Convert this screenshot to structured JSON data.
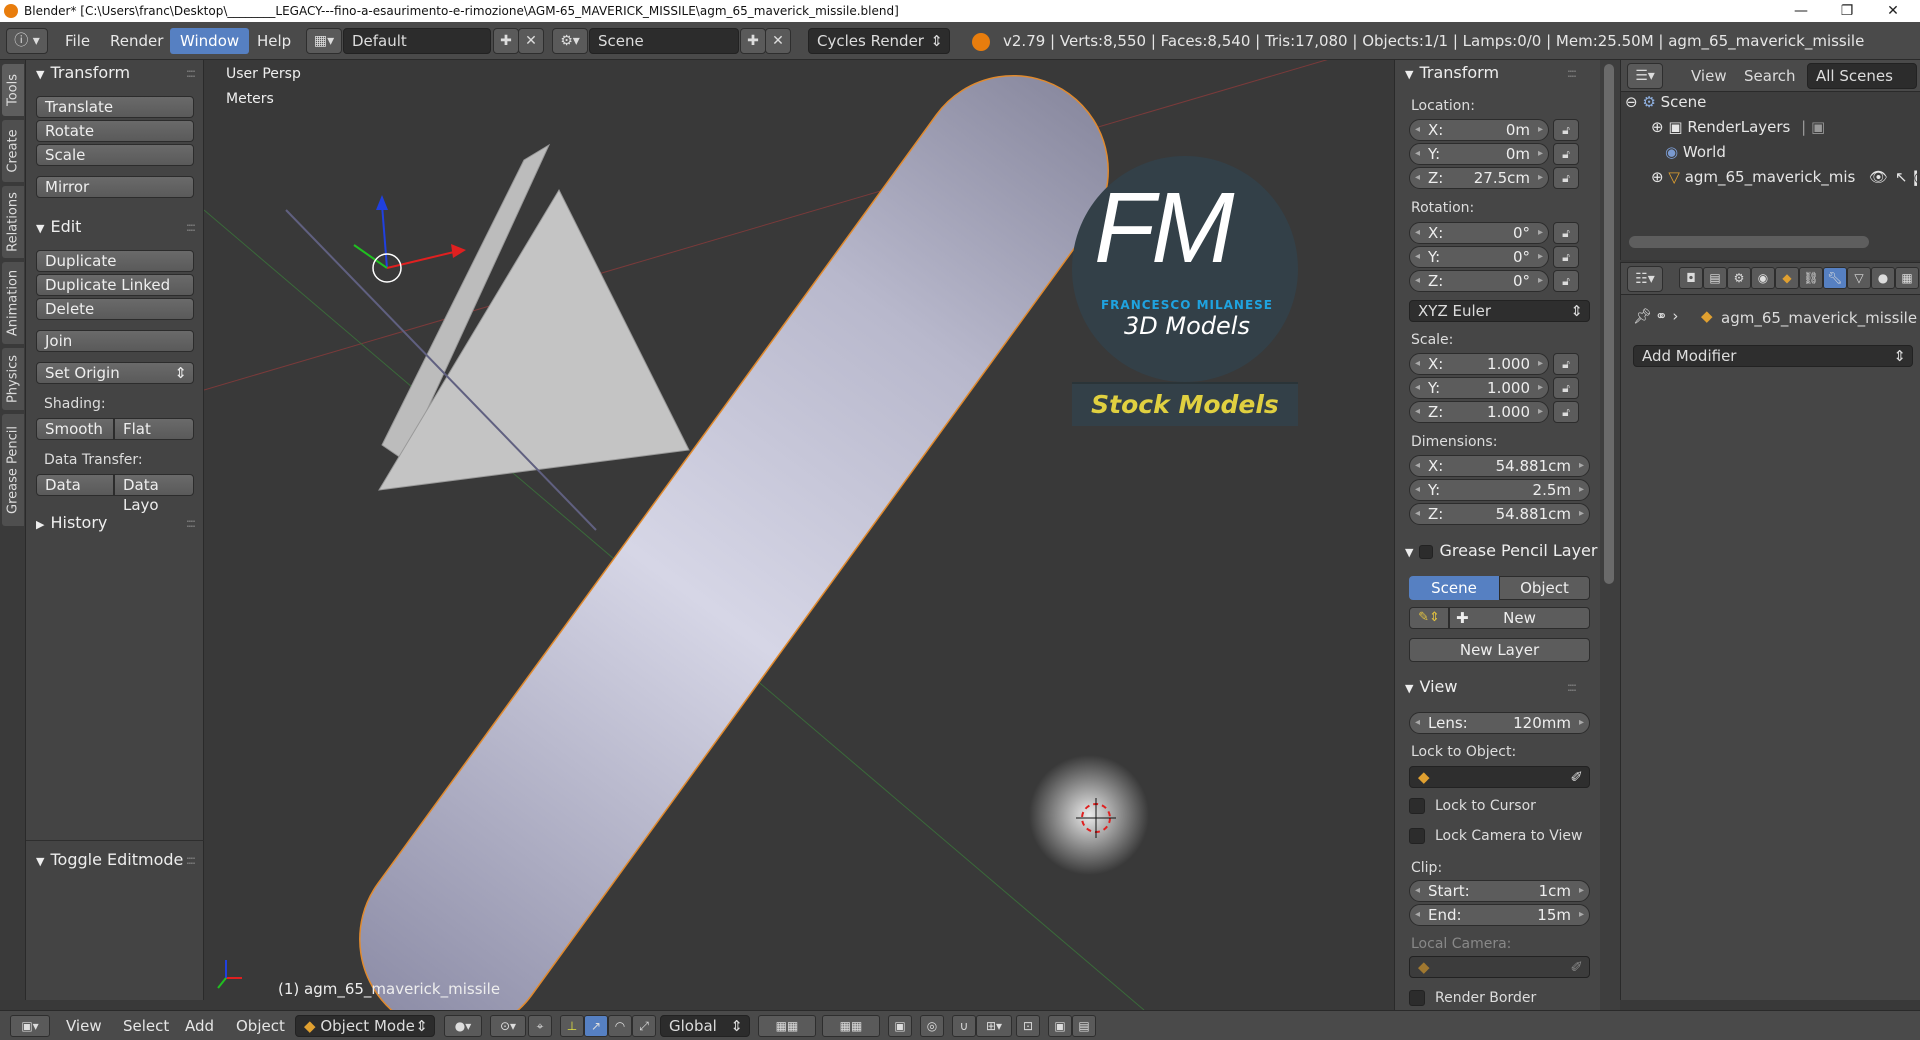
{
  "window": {
    "title": "Blender* [C:\\Users\\franc\\Desktop\\________LEGACY---fino-a-esaurimento-e-rimozione\\AGM-65_MAVERICK_MISSILE\\agm_65_maverick_missile.blend]",
    "minimize": "—",
    "maximize": "❐",
    "close": "✕"
  },
  "header": {
    "menus": [
      "File",
      "Render",
      "Window",
      "Help"
    ],
    "layout": "Default",
    "scene": "Scene",
    "engine": "Cycles Render",
    "stats": "v2.79 | Verts:8,550 | Faces:8,540 | Tris:17,080 | Objects:1/1 | Lamps:0/0 | Mem:25.50M | agm_65_maverick_missile"
  },
  "tabs": [
    "Tools",
    "Create",
    "Relations",
    "Animation",
    "Physics",
    "Grease Pencil"
  ],
  "toolshelf": {
    "transform_title": "Transform",
    "translate": "Translate",
    "rotate": "Rotate",
    "scale": "Scale",
    "mirror": "Mirror",
    "edit_title": "Edit",
    "duplicate": "Duplicate",
    "duplicate_linked": "Duplicate Linked",
    "delete": "Delete",
    "join": "Join",
    "set_origin": "Set Origin",
    "shading_label": "Shading:",
    "smooth": "Smooth",
    "flat": "Flat",
    "data_transfer_label": "Data Transfer:",
    "data": "Data",
    "data_layo": "Data Layo",
    "history_title": "History",
    "toggle_editmode": "Toggle Editmode"
  },
  "viewport": {
    "view_name": "User Persp",
    "units": "Meters",
    "object_label": "(1) agm_65_maverick_missile",
    "logo_letters": "FM",
    "logo_name": "FRANCESCO MILANESE",
    "logo_sub": "3D Models",
    "logo_banner": "Stock Models"
  },
  "npanel": {
    "transform_title": "Transform",
    "location_label": "Location:",
    "loc_x": "0m",
    "loc_y": "0m",
    "loc_z": "27.5cm",
    "rotation_label": "Rotation:",
    "rot_x": "0°",
    "rot_y": "0°",
    "rot_z": "0°",
    "rotation_mode": "XYZ Euler",
    "scale_label": "Scale:",
    "scale_x": "1.000",
    "scale_y": "1.000",
    "scale_z": "1.000",
    "dimensions_label": "Dimensions:",
    "dim_x": "54.881cm",
    "dim_y": "2.5m",
    "dim_z": "54.881cm",
    "axis_x": "X:",
    "axis_y": "Y:",
    "axis_z": "Z:",
    "gp_title": "Grease Pencil Layer",
    "gp_scene": "Scene",
    "gp_object": "Object",
    "gp_new": "New",
    "gp_new_layer": "New Layer",
    "view_title": "View",
    "lens_key": "Lens:",
    "lens_val": "120mm",
    "lock_to_object": "Lock to Object:",
    "lock_to_cursor": "Lock to Cursor",
    "lock_camera": "Lock Camera to View",
    "clip_label": "Clip:",
    "clip_start_key": "Start:",
    "clip_start_val": "1cm",
    "clip_end_key": "End:",
    "clip_end_val": "15m",
    "local_camera": "Local Camera:",
    "render_border": "Render Border"
  },
  "outliner": {
    "view": "View",
    "search": "Search",
    "filter": "All Scenes",
    "items": [
      "Scene",
      "RenderLayers",
      "World",
      "agm_65_maverick_mis"
    ]
  },
  "properties": {
    "object_name": "agm_65_maverick_missile",
    "add_modifier": "Add Modifier"
  },
  "bottombar": {
    "menus": [
      "View",
      "Select",
      "Add",
      "Object"
    ],
    "mode": "Object Mode",
    "orientation": "Global"
  },
  "colors": {
    "accent": "#5680c2",
    "logo_blue": "#1fa3e0",
    "logo_yellow": "#e0d040"
  }
}
